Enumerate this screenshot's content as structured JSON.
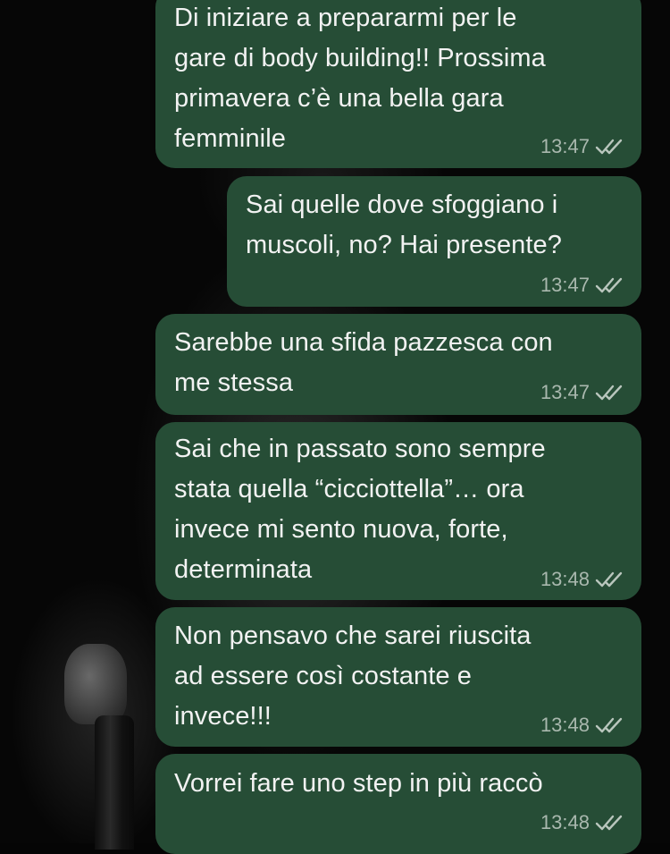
{
  "chat": {
    "messages": [
      {
        "text": "Di iniziare a prepararmi per le\ngare di body building!! Prossima\nprimavera c’è una bella gara\nfemminile",
        "time": "13:47",
        "status_icon": "double-check-icon"
      },
      {
        "text": "Sai quelle dove sfoggiano i\nmuscoli, no? Hai presente?",
        "time": "13:47",
        "status_icon": "double-check-icon"
      },
      {
        "text": "Sarebbe una sfida pazzesca con\nme stessa",
        "time": "13:47",
        "status_icon": "double-check-icon"
      },
      {
        "text": "Sai che in passato sono sempre\nstata quella “cicciottella”… ora\ninvece mi sento nuova, forte,\ndeterminata",
        "time": "13:48",
        "status_icon": "double-check-icon"
      },
      {
        "text": "Non pensavo che sarei riuscita\nad essere così costante e\ninvece!!!",
        "time": "13:48",
        "status_icon": "double-check-icon"
      },
      {
        "text": "Vorrei fare uno step in più raccò",
        "time": "13:48",
        "status_icon": "double-check-icon"
      }
    ]
  },
  "colors": {
    "bubble_outgoing": "#264d36",
    "message_text": "#f2f2f2",
    "timestamp": "#a9b8ae",
    "ticks": "#b9c6bd",
    "background": "#050505"
  }
}
